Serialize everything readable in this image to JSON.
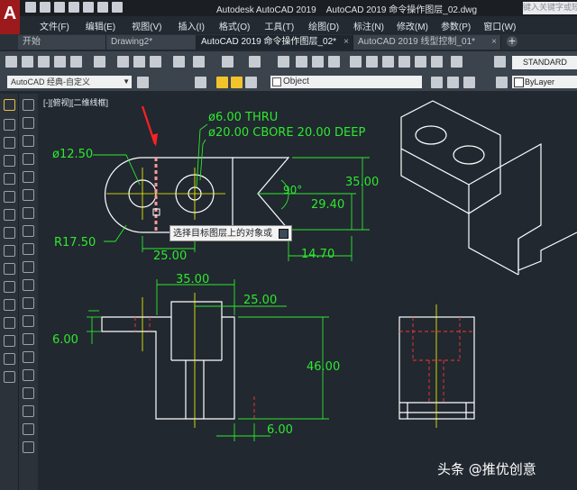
{
  "app": {
    "title": "Autodesk AutoCAD 2019",
    "filename": "AutoCAD 2019 命令操作图层_02.dwg",
    "search_placeholder": "键入关键字或短语",
    "logo_letter": "A"
  },
  "menu": [
    "文件(F)",
    "编辑(E)",
    "视图(V)",
    "插入(I)",
    "格式(O)",
    "工具(T)",
    "绘图(D)",
    "标注(N)",
    "修改(M)",
    "参数(P)",
    "窗口(W)"
  ],
  "tabs": [
    {
      "label": "开始",
      "active": false
    },
    {
      "label": "Drawing2*",
      "active": false
    },
    {
      "label": "AutoCAD 2019 命令操作图层_02*",
      "active": true
    },
    {
      "label": "AutoCAD 2019 线型控制_01*",
      "active": false
    }
  ],
  "toolbar": {
    "workspace": "AutoCAD 经典-自定义",
    "layer_name": "Object",
    "text_style": "STANDARD",
    "color": "ByLayer"
  },
  "viewport_label": "[-][俯视][二维线框]",
  "tooltip": "选择目标图层上的对象或",
  "dimensions": {
    "hole_thru": "ø6.00  THRU",
    "cbore": "ø20.00  CBORE  20.00  DEEP",
    "dia_12_50": "ø12.50",
    "r17_50": "R17.50",
    "angle_90": "90°",
    "d35_right": "35.00",
    "d29_40": "29.40",
    "d25_top": "25.00",
    "d14_70": "14.70",
    "d35_front": "35.00",
    "d25_front": "25.00",
    "d6_left": "6.00",
    "d46": "46.00",
    "d6_bottom": "6.00"
  },
  "watermark": "头条 @推优创意",
  "colors": {
    "background": "#212830",
    "dimension": "#2ee82e",
    "geometry": "#ffffff",
    "centerline": "#ffff00",
    "hidden": "#ff3333",
    "arrow": "#ff2020"
  }
}
